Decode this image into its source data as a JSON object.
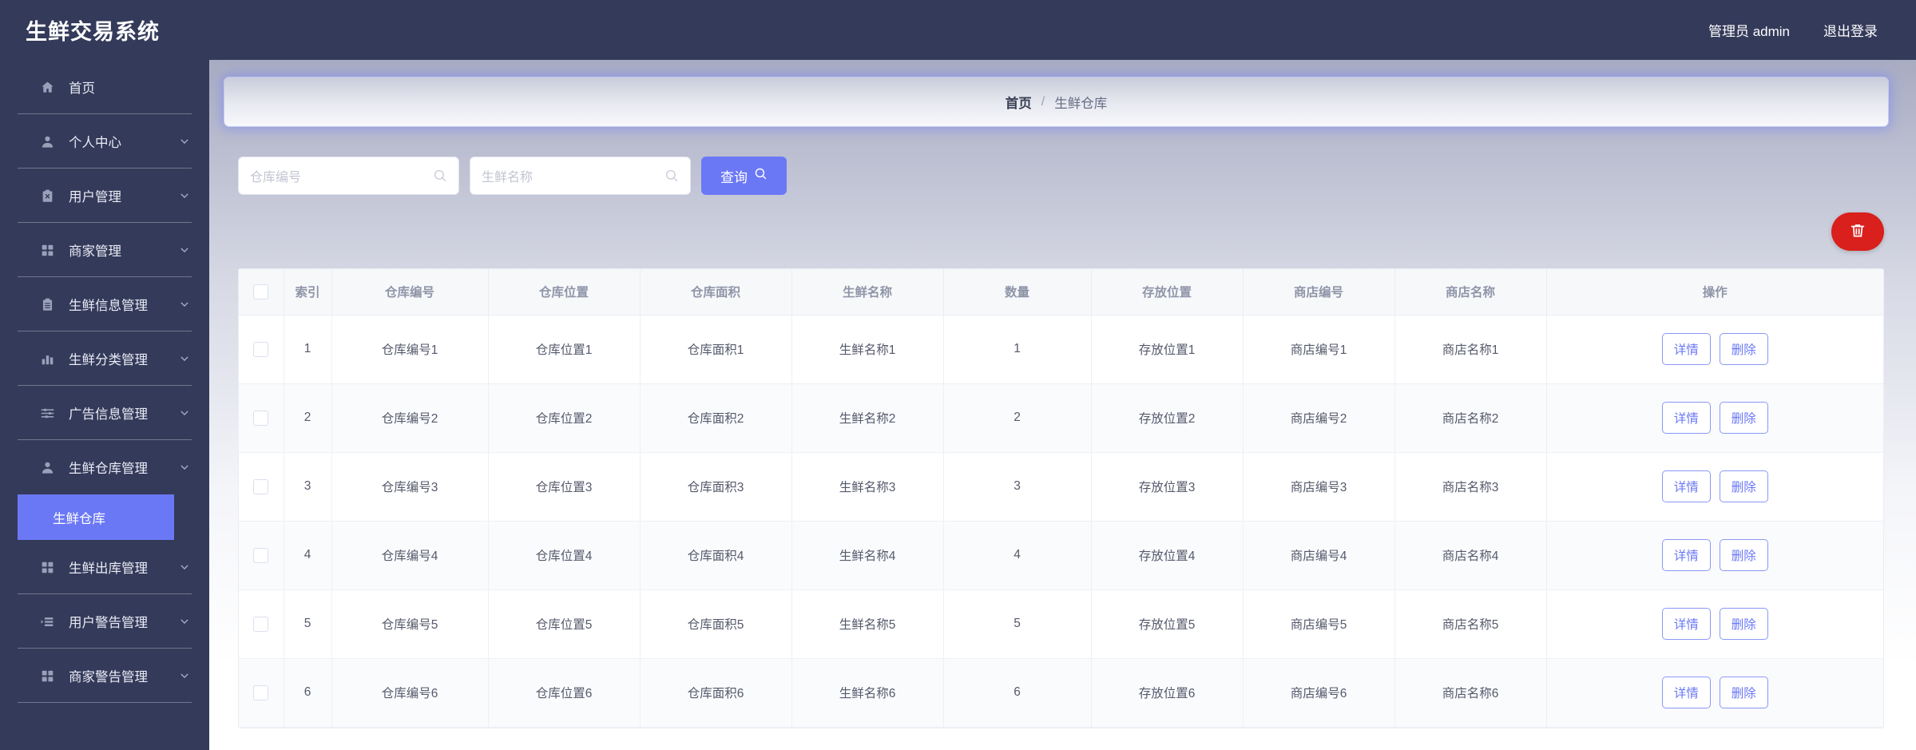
{
  "brand": {
    "title": "生鲜交易系统"
  },
  "topbar": {
    "user_label": "管理员 admin",
    "logout_label": "退出登录"
  },
  "breadcrumb": {
    "home": "首页",
    "separator": "/",
    "current": "生鲜仓库"
  },
  "sidebar": {
    "items": [
      {
        "label": "首页",
        "icon": "home-icon",
        "expandable": false
      },
      {
        "label": "个人中心",
        "icon": "user-icon",
        "expandable": true
      },
      {
        "label": "用户管理",
        "icon": "clipboard-x-icon",
        "expandable": true
      },
      {
        "label": "商家管理",
        "icon": "grid-icon",
        "expandable": true
      },
      {
        "label": "生鲜信息管理",
        "icon": "clipboard-list-icon",
        "expandable": true
      },
      {
        "label": "生鲜分类管理",
        "icon": "bar-chart-icon",
        "expandable": true
      },
      {
        "label": "广告信息管理",
        "icon": "sliders-icon",
        "expandable": true
      },
      {
        "label": "生鲜仓库管理",
        "icon": "user-icon",
        "expandable": true
      },
      {
        "label": "生鲜出库管理",
        "icon": "grid-icon",
        "expandable": true
      },
      {
        "label": "用户警告管理",
        "icon": "list-icon",
        "expandable": true
      },
      {
        "label": "商家警告管理",
        "icon": "grid-icon",
        "expandable": true
      }
    ],
    "active_submenu": {
      "label": "生鲜仓库",
      "parent_index": 7
    }
  },
  "search": {
    "field1_placeholder": "仓库编号",
    "field1_value": "",
    "field2_placeholder": "生鲜名称",
    "field2_value": "",
    "query_label": "查询",
    "query_icon": "search-icon"
  },
  "toolbar": {
    "bulk_delete_icon": "trash-icon",
    "bulk_delete_color": "#d9201c"
  },
  "table": {
    "columns": [
      "",
      "索引",
      "仓库编号",
      "仓库位置",
      "仓库面积",
      "生鲜名称",
      "数量",
      "存放位置",
      "商店编号",
      "商店名称",
      "操作"
    ],
    "rows": [
      {
        "index": "1",
        "warehouse_no": "仓库编号1",
        "warehouse_loc": "仓库位置1",
        "warehouse_area": "仓库面积1",
        "product": "生鲜名称1",
        "qty": "1",
        "store_loc": "存放位置1",
        "shop_no": "商店编号1",
        "shop_name": "商店名称1"
      },
      {
        "index": "2",
        "warehouse_no": "仓库编号2",
        "warehouse_loc": "仓库位置2",
        "warehouse_area": "仓库面积2",
        "product": "生鲜名称2",
        "qty": "2",
        "store_loc": "存放位置2",
        "shop_no": "商店编号2",
        "shop_name": "商店名称2"
      },
      {
        "index": "3",
        "warehouse_no": "仓库编号3",
        "warehouse_loc": "仓库位置3",
        "warehouse_area": "仓库面积3",
        "product": "生鲜名称3",
        "qty": "3",
        "store_loc": "存放位置3",
        "shop_no": "商店编号3",
        "shop_name": "商店名称3"
      },
      {
        "index": "4",
        "warehouse_no": "仓库编号4",
        "warehouse_loc": "仓库位置4",
        "warehouse_area": "仓库面积4",
        "product": "生鲜名称4",
        "qty": "4",
        "store_loc": "存放位置4",
        "shop_no": "商店编号4",
        "shop_name": "商店名称4"
      },
      {
        "index": "5",
        "warehouse_no": "仓库编号5",
        "warehouse_loc": "仓库位置5",
        "warehouse_area": "仓库面积5",
        "product": "生鲜名称5",
        "qty": "5",
        "store_loc": "存放位置5",
        "shop_no": "商店编号5",
        "shop_name": "商店名称5"
      },
      {
        "index": "6",
        "warehouse_no": "仓库编号6",
        "warehouse_loc": "仓库位置6",
        "warehouse_area": "仓库面积6",
        "product": "生鲜名称6",
        "qty": "6",
        "store_loc": "存放位置6",
        "shop_no": "商店编号6",
        "shop_name": "商店名称6"
      }
    ],
    "row_actions": {
      "detail_label": "详情",
      "delete_label": "删除"
    }
  },
  "colors": {
    "sidebar_bg": "#343a5a",
    "accent": "#6b78f5",
    "danger": "#d9201c"
  }
}
